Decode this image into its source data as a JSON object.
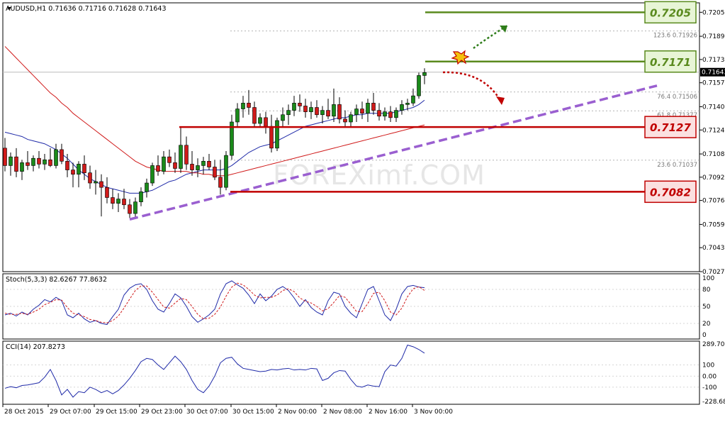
{
  "chart_data": {
    "type": "candlestick",
    "symbol": "AUDUSD",
    "timeframe": "H1",
    "header": "AUDUSD,H1  0.71636 0.71716 0.71628 0.71643",
    "current_price_label": "0.71643",
    "price_axis_labels": [
      "0.72055",
      "0.71890",
      "0.71730",
      "0.71570",
      "0.71405",
      "0.71245",
      "0.71080",
      "0.70920",
      "0.70760",
      "0.70595",
      "0.70435",
      "0.70270"
    ],
    "x_axis_labels": [
      "28 Oct 2015",
      "29 Oct 07:00",
      "29 Oct 15:00",
      "29 Oct 23:00",
      "30 Oct 07:00",
      "30 Oct 15:00",
      "2 Nov 00:00",
      "2 Nov 08:00",
      "2 Nov 16:00",
      "3 Nov 00:00"
    ],
    "ylim": [
      0.7027,
      0.7212
    ],
    "candles": [
      {
        "o": 0.7112,
        "h": 0.7119,
        "l": 0.7096,
        "c": 0.71
      },
      {
        "o": 0.71,
        "h": 0.7109,
        "l": 0.7093,
        "c": 0.7106
      },
      {
        "o": 0.7106,
        "h": 0.7112,
        "l": 0.7092,
        "c": 0.7096
      },
      {
        "o": 0.7096,
        "h": 0.7104,
        "l": 0.709,
        "c": 0.7102
      },
      {
        "o": 0.7102,
        "h": 0.711,
        "l": 0.7097,
        "c": 0.71
      },
      {
        "o": 0.71,
        "h": 0.7107,
        "l": 0.7096,
        "c": 0.7105
      },
      {
        "o": 0.7105,
        "h": 0.711,
        "l": 0.7098,
        "c": 0.7101
      },
      {
        "o": 0.7101,
        "h": 0.7108,
        "l": 0.7097,
        "c": 0.7104
      },
      {
        "o": 0.7104,
        "h": 0.7112,
        "l": 0.7099,
        "c": 0.71
      },
      {
        "o": 0.71,
        "h": 0.7115,
        "l": 0.7098,
        "c": 0.7111
      },
      {
        "o": 0.7111,
        "h": 0.7115,
        "l": 0.7101,
        "c": 0.7103
      },
      {
        "o": 0.7103,
        "h": 0.7108,
        "l": 0.7092,
        "c": 0.7097
      },
      {
        "o": 0.7097,
        "h": 0.7102,
        "l": 0.7085,
        "c": 0.7094
      },
      {
        "o": 0.7094,
        "h": 0.7103,
        "l": 0.7085,
        "c": 0.7101
      },
      {
        "o": 0.7101,
        "h": 0.7107,
        "l": 0.709,
        "c": 0.7095
      },
      {
        "o": 0.7095,
        "h": 0.71,
        "l": 0.7084,
        "c": 0.7088
      },
      {
        "o": 0.7088,
        "h": 0.7097,
        "l": 0.708,
        "c": 0.7089
      },
      {
        "o": 0.7089,
        "h": 0.7094,
        "l": 0.7065,
        "c": 0.7085
      },
      {
        "o": 0.7085,
        "h": 0.7092,
        "l": 0.7074,
        "c": 0.7078
      },
      {
        "o": 0.7078,
        "h": 0.7084,
        "l": 0.707,
        "c": 0.7074
      },
      {
        "o": 0.7074,
        "h": 0.7081,
        "l": 0.7068,
        "c": 0.7077
      },
      {
        "o": 0.7077,
        "h": 0.7084,
        "l": 0.707,
        "c": 0.7073
      },
      {
        "o": 0.7073,
        "h": 0.7077,
        "l": 0.7064,
        "c": 0.7067
      },
      {
        "o": 0.7067,
        "h": 0.7078,
        "l": 0.7064,
        "c": 0.7075
      },
      {
        "o": 0.7075,
        "h": 0.7085,
        "l": 0.7072,
        "c": 0.7082
      },
      {
        "o": 0.7082,
        "h": 0.7091,
        "l": 0.7078,
        "c": 0.7088
      },
      {
        "o": 0.7088,
        "h": 0.7102,
        "l": 0.7086,
        "c": 0.71
      },
      {
        "o": 0.71,
        "h": 0.7107,
        "l": 0.7093,
        "c": 0.7096
      },
      {
        "o": 0.7096,
        "h": 0.711,
        "l": 0.7094,
        "c": 0.7106
      },
      {
        "o": 0.7106,
        "h": 0.7111,
        "l": 0.7099,
        "c": 0.7102
      },
      {
        "o": 0.7102,
        "h": 0.7109,
        "l": 0.7095,
        "c": 0.7098
      },
      {
        "o": 0.7098,
        "h": 0.7126,
        "l": 0.7095,
        "c": 0.7114
      },
      {
        "o": 0.7114,
        "h": 0.712,
        "l": 0.7097,
        "c": 0.7101
      },
      {
        "o": 0.7101,
        "h": 0.711,
        "l": 0.7093,
        "c": 0.7097
      },
      {
        "o": 0.7097,
        "h": 0.7105,
        "l": 0.7092,
        "c": 0.71
      },
      {
        "o": 0.71,
        "h": 0.7106,
        "l": 0.7094,
        "c": 0.7103
      },
      {
        "o": 0.7103,
        "h": 0.7108,
        "l": 0.7097,
        "c": 0.7099
      },
      {
        "o": 0.7099,
        "h": 0.7104,
        "l": 0.709,
        "c": 0.7092
      },
      {
        "o": 0.7092,
        "h": 0.7104,
        "l": 0.708,
        "c": 0.7085
      },
      {
        "o": 0.7085,
        "h": 0.711,
        "l": 0.7083,
        "c": 0.7107
      },
      {
        "o": 0.7107,
        "h": 0.7135,
        "l": 0.7104,
        "c": 0.713
      },
      {
        "o": 0.713,
        "h": 0.7143,
        "l": 0.7126,
        "c": 0.7139
      },
      {
        "o": 0.7139,
        "h": 0.7148,
        "l": 0.7133,
        "c": 0.7143
      },
      {
        "o": 0.7143,
        "h": 0.7152,
        "l": 0.7135,
        "c": 0.714
      },
      {
        "o": 0.714,
        "h": 0.7144,
        "l": 0.7127,
        "c": 0.7129
      },
      {
        "o": 0.7129,
        "h": 0.7136,
        "l": 0.7126,
        "c": 0.7133
      },
      {
        "o": 0.7133,
        "h": 0.7137,
        "l": 0.7122,
        "c": 0.7127
      },
      {
        "o": 0.7127,
        "h": 0.7135,
        "l": 0.7109,
        "c": 0.7112
      },
      {
        "o": 0.7112,
        "h": 0.7133,
        "l": 0.711,
        "c": 0.7131
      },
      {
        "o": 0.7131,
        "h": 0.714,
        "l": 0.7126,
        "c": 0.7135
      },
      {
        "o": 0.7135,
        "h": 0.7142,
        "l": 0.7128,
        "c": 0.7138
      },
      {
        "o": 0.7138,
        "h": 0.7148,
        "l": 0.7134,
        "c": 0.7143
      },
      {
        "o": 0.7143,
        "h": 0.7149,
        "l": 0.7137,
        "c": 0.7141
      },
      {
        "o": 0.7141,
        "h": 0.7146,
        "l": 0.7133,
        "c": 0.7137
      },
      {
        "o": 0.7137,
        "h": 0.7144,
        "l": 0.7132,
        "c": 0.714
      },
      {
        "o": 0.714,
        "h": 0.7145,
        "l": 0.7133,
        "c": 0.7135
      },
      {
        "o": 0.7135,
        "h": 0.7141,
        "l": 0.7129,
        "c": 0.7138
      },
      {
        "o": 0.7138,
        "h": 0.7146,
        "l": 0.7132,
        "c": 0.7134
      },
      {
        "o": 0.7134,
        "h": 0.7153,
        "l": 0.713,
        "c": 0.7142
      },
      {
        "o": 0.7142,
        "h": 0.7147,
        "l": 0.7129,
        "c": 0.7132
      },
      {
        "o": 0.7132,
        "h": 0.7138,
        "l": 0.7126,
        "c": 0.713
      },
      {
        "o": 0.713,
        "h": 0.7137,
        "l": 0.7126,
        "c": 0.7135
      },
      {
        "o": 0.7135,
        "h": 0.7142,
        "l": 0.713,
        "c": 0.7139
      },
      {
        "o": 0.7139,
        "h": 0.7144,
        "l": 0.7132,
        "c": 0.7136
      },
      {
        "o": 0.7136,
        "h": 0.7146,
        "l": 0.713,
        "c": 0.7143
      },
      {
        "o": 0.7143,
        "h": 0.715,
        "l": 0.7135,
        "c": 0.7138
      },
      {
        "o": 0.7138,
        "h": 0.7143,
        "l": 0.7131,
        "c": 0.7134
      },
      {
        "o": 0.7134,
        "h": 0.714,
        "l": 0.7131,
        "c": 0.7137
      },
      {
        "o": 0.7137,
        "h": 0.7141,
        "l": 0.713,
        "c": 0.7133
      },
      {
        "o": 0.7133,
        "h": 0.714,
        "l": 0.713,
        "c": 0.7138
      },
      {
        "o": 0.7138,
        "h": 0.7145,
        "l": 0.7135,
        "c": 0.7142
      },
      {
        "o": 0.7142,
        "h": 0.7146,
        "l": 0.7138,
        "c": 0.7143
      },
      {
        "o": 0.7143,
        "h": 0.7153,
        "l": 0.7141,
        "c": 0.7148
      },
      {
        "o": 0.7148,
        "h": 0.7164,
        "l": 0.7146,
        "c": 0.7162
      },
      {
        "o": 0.7162,
        "h": 0.7167,
        "l": 0.7156,
        "c": 0.7164
      }
    ],
    "moving_averages": [
      {
        "name": "MA-blue",
        "color": "#1f2aa8",
        "values": [
          0.7123,
          0.7122,
          0.7121,
          0.712,
          0.7118,
          0.7117,
          0.7116,
          0.7115,
          0.7113,
          0.7111,
          0.7108,
          0.7105,
          0.7101,
          0.7097,
          0.7094,
          0.7091,
          0.7089,
          0.7087,
          0.7085,
          0.7084,
          0.7083,
          0.7082,
          0.7081,
          0.7081,
          0.7081,
          0.7082,
          0.7083,
          0.7085,
          0.7087,
          0.7089,
          0.709,
          0.7092,
          0.7094,
          0.7095,
          0.7096,
          0.7097,
          0.7097,
          0.7097,
          0.7097,
          0.7098,
          0.71,
          0.7103,
          0.7106,
          0.7109,
          0.7111,
          0.7113,
          0.7114,
          0.7115,
          0.7117,
          0.7119,
          0.7121,
          0.7123,
          0.7125,
          0.7127,
          0.7128,
          0.7129,
          0.713,
          0.7131,
          0.7132,
          0.7133,
          0.7133,
          0.7134,
          0.7135,
          0.7135,
          0.7136,
          0.7136,
          0.7136,
          0.7136,
          0.7136,
          0.7137,
          0.7138,
          0.7139,
          0.714,
          0.7142,
          0.7145
        ]
      },
      {
        "name": "MA-red",
        "color": "#d01a1a",
        "values": [
          0.7182,
          0.7178,
          0.7174,
          0.717,
          0.7166,
          0.7162,
          0.7158,
          0.7154,
          0.715,
          0.7147,
          0.7143,
          0.714,
          0.7136,
          0.7133,
          0.713,
          0.7127,
          0.7124,
          0.7121,
          0.7118,
          0.7115,
          0.7112,
          0.7109,
          0.7106,
          0.7103,
          0.7101,
          0.7099,
          0.7098,
          0.7097,
          0.7096,
          0.7096,
          0.7096,
          0.7096,
          0.7096,
          0.7095,
          0.7095,
          0.7094,
          0.7094,
          0.7093,
          0.7093,
          0.7093,
          0.7094,
          0.7095,
          0.7096,
          0.7097,
          0.7098,
          0.7099,
          0.71,
          0.7101,
          0.7102,
          0.7103,
          0.7104,
          0.7105,
          0.7106,
          0.7107,
          0.7108,
          0.7109,
          0.711,
          0.7111,
          0.7112,
          0.7113,
          0.7114,
          0.7115,
          0.7116,
          0.7117,
          0.7118,
          0.7119,
          0.712,
          0.7121,
          0.7122,
          0.7123,
          0.7124,
          0.7125,
          0.7126,
          0.7127,
          0.7128
        ]
      }
    ],
    "fibonacci_levels": [
      {
        "label": "123.6 0.71926",
        "price": 0.71926
      },
      {
        "label": "76.4  0.71506",
        "price": 0.71506
      },
      {
        "label": "61.8  0.71377",
        "price": 0.71377
      },
      {
        "label": "23.6  0.71037",
        "price": 0.71037
      }
    ],
    "price_levels": [
      {
        "label": "0.7205",
        "price": 0.72055,
        "type": "target",
        "color": "#5a8a1e",
        "bg": "#e8f5d6"
      },
      {
        "label": "0.7171",
        "price": 0.71716,
        "type": "resistance",
        "color": "#5a8a1e",
        "bg": "#e8f5d6"
      },
      {
        "label": "0.7127",
        "price": 0.71265,
        "type": "support",
        "color": "#c00000",
        "bg": "#fbe0e0"
      },
      {
        "label": "0.7082",
        "price": 0.7082,
        "type": "support",
        "color": "#c00000",
        "bg": "#fbe0e0"
      }
    ],
    "trendline": {
      "color": "#9a5fd0",
      "from": {
        "bar": 22,
        "price": 0.7063
      },
      "to": {
        "bar": 115,
        "price": 0.7155
      }
    },
    "watermark": "FOREXimf.COM",
    "stochastic": {
      "label": "Stoch(5,3,3) 82.6267 77.8632",
      "axis_labels": [
        "100",
        "80",
        "50",
        "20",
        "0"
      ],
      "k": [
        35,
        38,
        33,
        40,
        35,
        45,
        52,
        62,
        58,
        66,
        60,
        35,
        30,
        38,
        28,
        22,
        25,
        20,
        18,
        32,
        45,
        70,
        82,
        88,
        90,
        80,
        60,
        45,
        40,
        55,
        72,
        65,
        50,
        32,
        22,
        28,
        35,
        45,
        72,
        90,
        95,
        88,
        82,
        70,
        55,
        72,
        60,
        68,
        80,
        85,
        78,
        65,
        50,
        62,
        48,
        40,
        35,
        60,
        75,
        72,
        50,
        38,
        30,
        55,
        80,
        85,
        60,
        35,
        25,
        45,
        72,
        85,
        87,
        84,
        83
      ],
      "d": [
        38,
        36,
        36,
        38,
        36,
        40,
        45,
        53,
        57,
        62,
        61,
        48,
        38,
        35,
        32,
        27,
        25,
        22,
        21,
        25,
        33,
        47,
        63,
        78,
        86,
        86,
        75,
        62,
        49,
        47,
        56,
        64,
        62,
        50,
        36,
        28,
        29,
        36,
        49,
        68,
        84,
        91,
        88,
        80,
        70,
        65,
        66,
        66,
        70,
        78,
        81,
        76,
        65,
        59,
        56,
        50,
        42,
        46,
        57,
        69,
        66,
        54,
        41,
        41,
        55,
        73,
        75,
        60,
        40,
        35,
        47,
        67,
        81,
        85,
        78
      ]
    },
    "cci": {
      "label": "CCI(14) 207.8273",
      "axis_labels": [
        "289.709",
        "100",
        "0.00",
        "-100",
        "-228.683"
      ],
      "values": [
        -110,
        -95,
        -105,
        -85,
        -80,
        -70,
        -60,
        -10,
        60,
        -40,
        -170,
        -120,
        -190,
        -140,
        -150,
        -100,
        -120,
        -150,
        -130,
        -160,
        -130,
        -80,
        -20,
        50,
        130,
        160,
        150,
        100,
        60,
        120,
        180,
        130,
        60,
        -40,
        -120,
        -150,
        -90,
        0,
        120,
        160,
        170,
        110,
        70,
        60,
        50,
        40,
        45,
        60,
        55,
        65,
        70,
        55,
        60,
        55,
        70,
        65,
        -40,
        -20,
        30,
        50,
        45,
        -30,
        -90,
        -100,
        -80,
        -90,
        -95,
        40,
        100,
        90,
        160,
        280,
        265,
        240,
        207
      ]
    }
  }
}
